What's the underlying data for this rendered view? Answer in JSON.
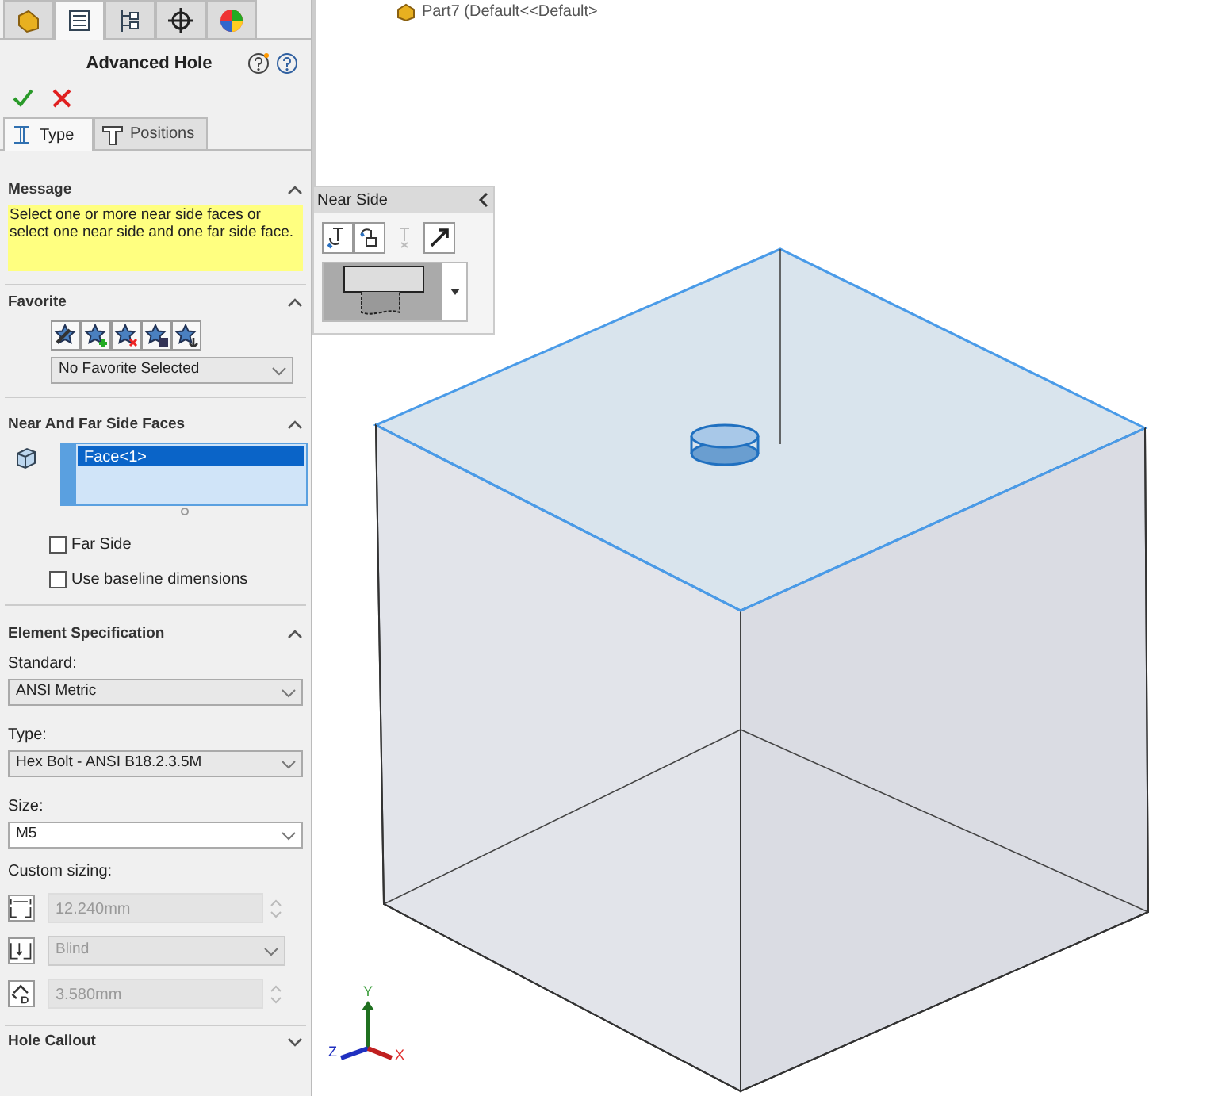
{
  "document_label": "Part7 (Default<<Default>",
  "manager_tabs": [
    {
      "selected": false
    },
    {
      "selected": true
    },
    {
      "selected": false
    },
    {
      "selected": false
    },
    {
      "selected": false
    }
  ],
  "title": "Advanced Hole",
  "sub_tabs": [
    {
      "label": "Type",
      "selected": true
    },
    {
      "label": "Positions",
      "selected": false
    }
  ],
  "message": {
    "title": "Message",
    "expanded": true,
    "text": "Select one or more near side faces or select one near side and one far side face."
  },
  "favorite": {
    "title": "Favorite",
    "expanded": true,
    "dropdown": "No Favorite Selected"
  },
  "faces": {
    "title": "Near And Far Side Faces",
    "expanded": true,
    "selection": [
      {
        "label": "Face<1>",
        "selected": true
      }
    ],
    "checkboxes": [
      {
        "label": "Far Side",
        "checked": false
      },
      {
        "label": "Use baseline dimensions",
        "checked": false
      }
    ]
  },
  "element_spec": {
    "title": "Element Specification",
    "expanded": true,
    "fields": [
      {
        "label": "Standard:",
        "value": "ANSI Metric"
      },
      {
        "label": "Type:",
        "value": "Hex Bolt - ANSI B18.2.3.5M"
      },
      {
        "label": "Size:",
        "value": "M5"
      }
    ],
    "custom_label": "Custom sizing:",
    "custom": [
      {
        "kind": "spin",
        "value": "12.240mm",
        "disabled": true
      },
      {
        "kind": "dropdown",
        "value": "Blind",
        "disabled": true
      },
      {
        "kind": "spin",
        "value": "3.580mm",
        "disabled": true
      }
    ]
  },
  "hole_callout": {
    "title": "Hole Callout",
    "expanded": false
  },
  "near_side": {
    "title": "Near Side"
  },
  "triad": [
    {
      "label": "Y"
    },
    {
      "label": "Z"
    },
    {
      "label": "X"
    }
  ]
}
